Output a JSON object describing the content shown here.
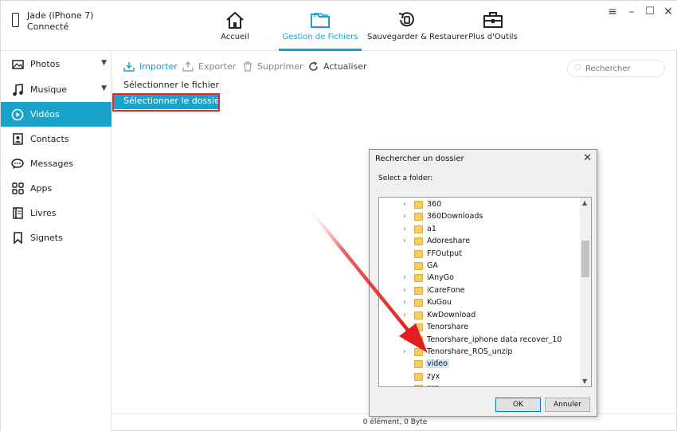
{
  "device": {
    "name": "Jade (iPhone 7)",
    "status": "Connecté"
  },
  "nav": [
    {
      "label": "Accueil",
      "icon": "home-icon"
    },
    {
      "label": "Gestion de Fichiers",
      "icon": "folder-icon"
    },
    {
      "label": "Sauvegarder & Restaurer",
      "icon": "backup-icon"
    },
    {
      "label": "Plus d'Outils",
      "icon": "toolbox-icon"
    }
  ],
  "sidebar": {
    "items": [
      {
        "label": "Photos",
        "icon": "photos-icon"
      },
      {
        "label": "Musique",
        "icon": "music-icon"
      },
      {
        "label": "Vidéos",
        "icon": "video-icon"
      },
      {
        "label": "Contacts",
        "icon": "contacts-icon"
      },
      {
        "label": "Messages",
        "icon": "messages-icon"
      },
      {
        "label": "Apps",
        "icon": "apps-icon"
      },
      {
        "label": "Livres",
        "icon": "books-icon"
      },
      {
        "label": "Signets",
        "icon": "bookmark-icon"
      }
    ]
  },
  "toolbar": {
    "import": "Importer",
    "export": "Exporter",
    "delete": "Supprimer",
    "refresh": "Actualiser",
    "search_placeholder": "Rechercher"
  },
  "dropdown": {
    "select_file": "Sélectionner le fichier",
    "select_folder": "Sélectionner le dossier"
  },
  "status": "0 élément, 0 Byte",
  "dialog": {
    "title": "Rechercher un dossier",
    "subtitle": "Select a folder:",
    "folders": [
      "360",
      "360Downloads",
      "a1",
      "Adoreshare",
      "FFOutput",
      "GA",
      "iAnyGo",
      "iCareFone",
      "KuGou",
      "KwDownload",
      "Tenorshare",
      "Tenorshare_iphone data recover_10",
      "Tenorshare_ROS_unzip",
      "video",
      "zyx",
      "zzz"
    ],
    "selected": "video",
    "ok": "OK",
    "cancel": "Annuler"
  },
  "colors": {
    "accent": "#1aa3c8",
    "highlight_outline": "#d62b2b",
    "arrow": "#e02020"
  }
}
